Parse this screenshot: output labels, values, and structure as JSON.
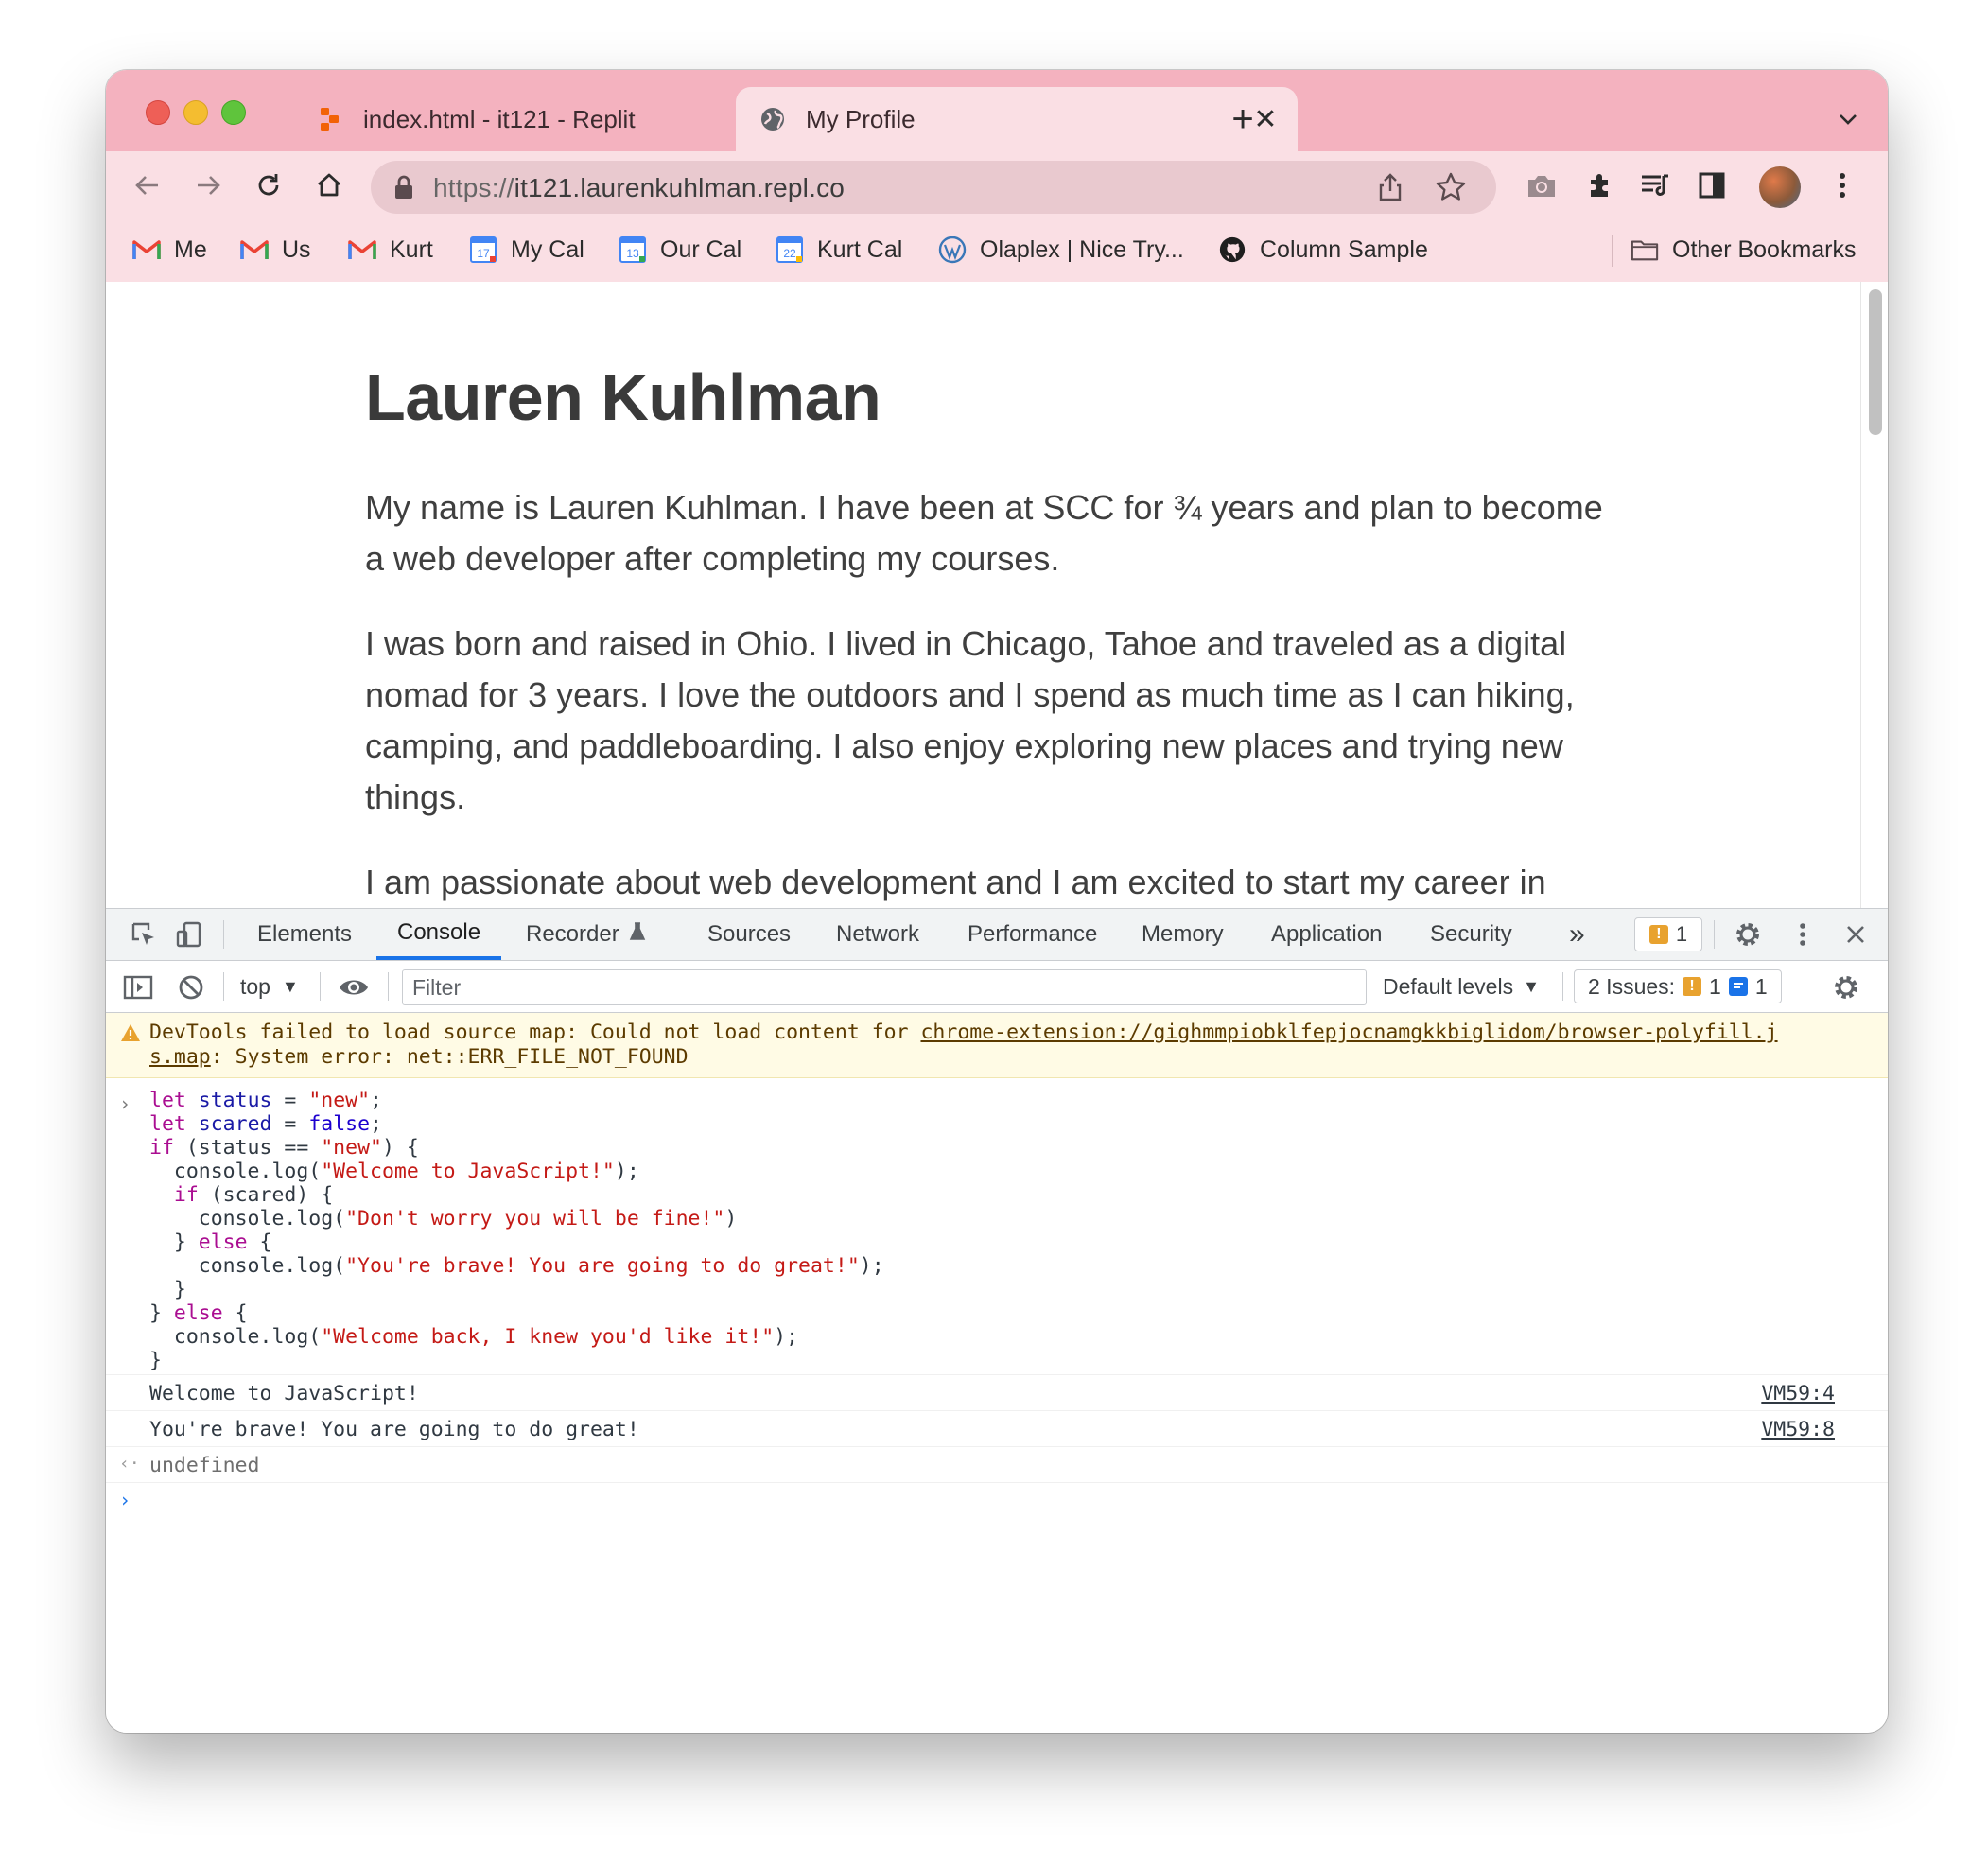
{
  "tabs": [
    {
      "title": "index.html - it121 - Replit",
      "favicon": "replit-icon",
      "active": false
    },
    {
      "title": "My Profile",
      "favicon": "globe-icon",
      "active": true
    }
  ],
  "toolbar": {
    "url_scheme": "https://",
    "url_host": "it121.laurenkuhlman.repl.co"
  },
  "bookmarks": [
    {
      "label": "Me",
      "icon": "gmail-icon"
    },
    {
      "label": "Us",
      "icon": "gmail-icon"
    },
    {
      "label": "Kurt",
      "icon": "gmail-icon"
    },
    {
      "label": "My Cal",
      "icon": "calendar-icon",
      "day": "17"
    },
    {
      "label": "Our Cal",
      "icon": "calendar-icon",
      "day": "13"
    },
    {
      "label": "Kurt Cal",
      "icon": "calendar-icon",
      "day": "22"
    },
    {
      "label": "Olaplex | Nice Try...",
      "icon": "wordpress-icon"
    },
    {
      "label": "Column Sample",
      "icon": "github-icon"
    }
  ],
  "other_bookmarks": "Other Bookmarks",
  "page": {
    "heading": "Lauren Kuhlman",
    "p1": "My name is Lauren Kuhlman. I have been at SCC for ¾ years and plan to become a web developer after completing my courses.",
    "p2": "I was born and raised in Ohio. I lived in Chicago, Tahoe and traveled as a digital nomad for 3 years. I love the outdoors and I spend as much time as I can hiking, camping, and paddleboarding. I also enjoy exploring new places and trying new things.",
    "p3": "I am passionate about web development and I am excited to start my career in"
  },
  "devtools": {
    "tabs": [
      "Elements",
      "Console",
      "Recorder",
      "Sources",
      "Network",
      "Performance",
      "Memory",
      "Application",
      "Security"
    ],
    "active_tab": "Console",
    "more_tabs": "»",
    "issues_badge_count": "1",
    "context": "top",
    "filter_placeholder": "Filter",
    "levels": "Default levels",
    "issues_label": "2 Issues:",
    "issues_warn_count": "1",
    "issues_info_count": "1",
    "warning_line1": "DevTools failed to load source map: Could not load content for ",
    "warning_link1": "chrome-extension://gighmmpiobklfepjocnamgkkbiglidom/browser-polyfill.j",
    "warning_link2": "s.map",
    "warning_line2_rest": ": System error: net::ERR_FILE_NOT_FOUND",
    "outputs": [
      {
        "message": "Welcome to JavaScript!",
        "source": "VM59:4"
      },
      {
        "message": "You're brave! You are going to do great!",
        "source": "VM59:8"
      }
    ],
    "return_value": "undefined"
  },
  "colors": {
    "tabstrip": "#f4b2bf",
    "toolbar": "#fadfe4",
    "devtools_accent": "#1a73e8"
  }
}
